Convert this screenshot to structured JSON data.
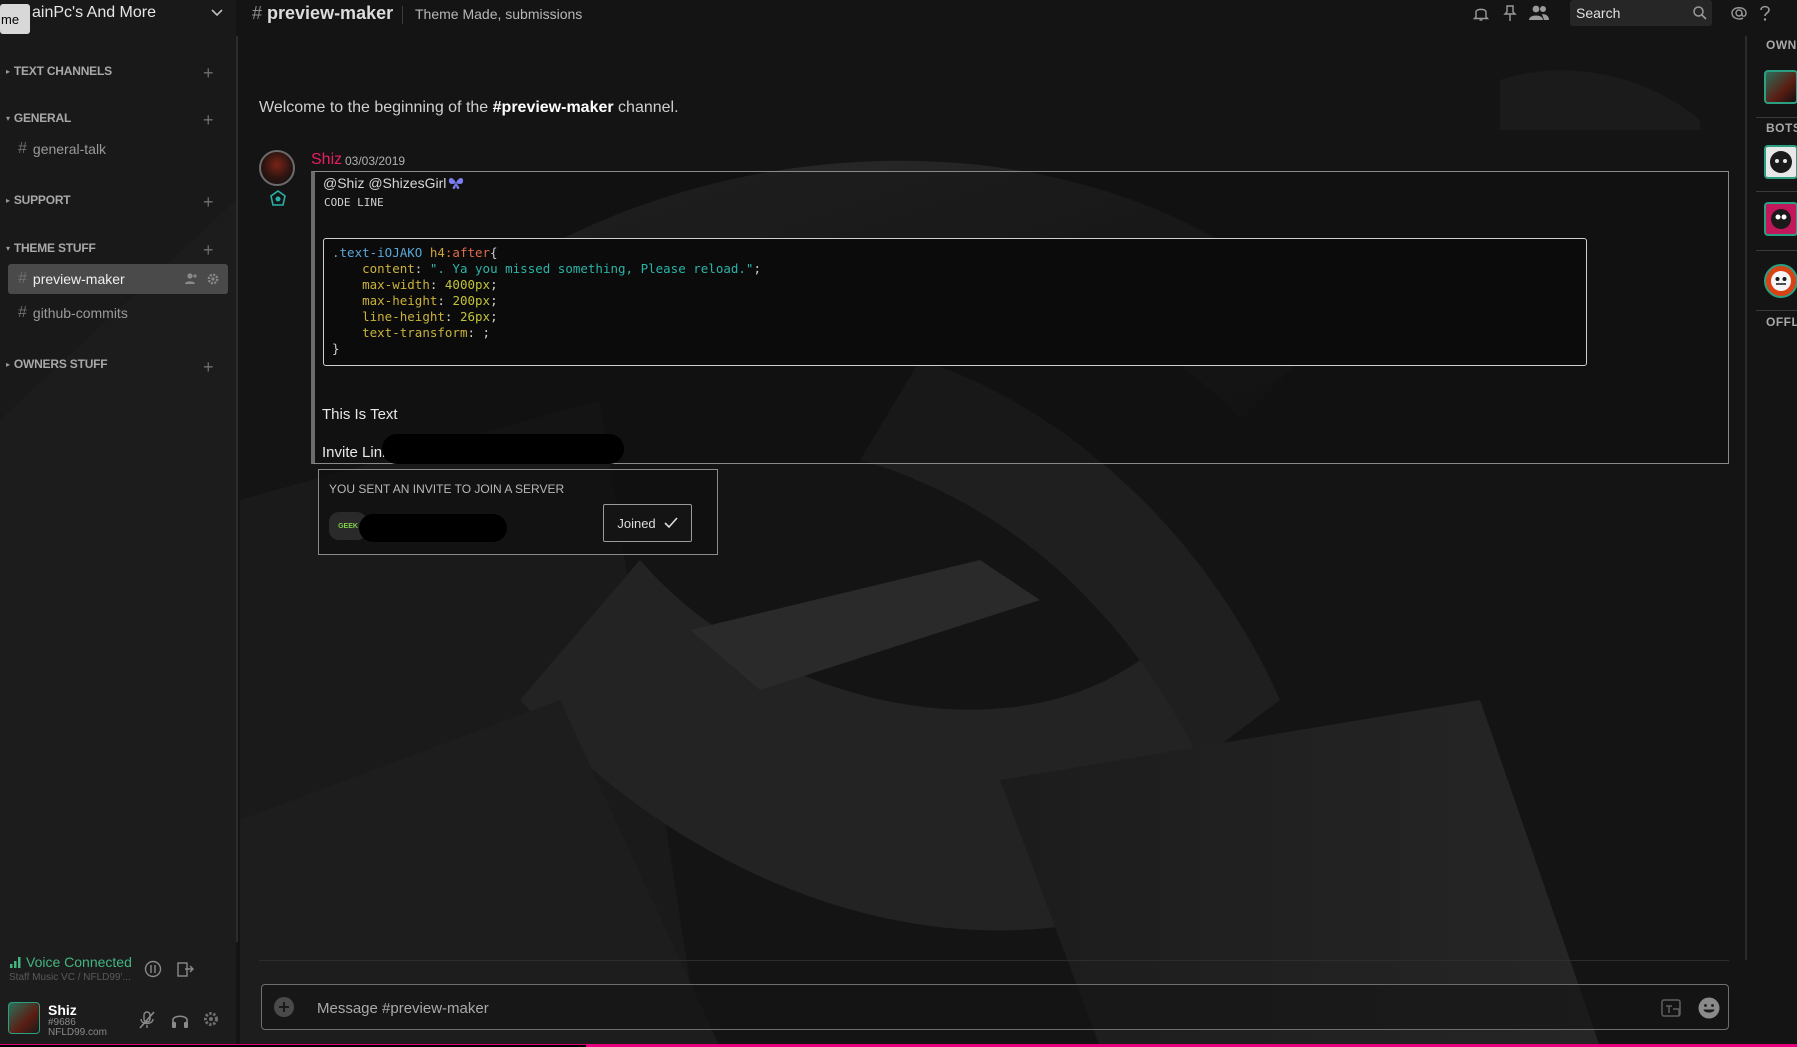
{
  "server": {
    "badge": "me",
    "name": "ainPc's And More"
  },
  "sidebar": {
    "categories": [
      {
        "label": "TEXT CHANNELS"
      },
      {
        "label": "GENERAL"
      },
      {
        "label": "SUPPORT"
      },
      {
        "label": "THEME STUFF"
      },
      {
        "label": "OWNERS STUFF"
      }
    ],
    "channels": [
      {
        "label": "general-talk"
      },
      {
        "label": "preview-maker"
      },
      {
        "label": "github-commits"
      }
    ]
  },
  "voice": {
    "status": "Voice Connected",
    "sub": "Staff Music VC / NFLD99'..."
  },
  "user": {
    "name": "Shiz",
    "discriminator": "#9686",
    "site": "NFLD99.com"
  },
  "topbar": {
    "hash": "#",
    "channel": "preview-maker",
    "topic": "Theme Made, submissions",
    "search_placeholder": "Search"
  },
  "welcome": {
    "prefix": "Welcome to the beginning of the ",
    "channel": "#preview-maker",
    "suffix": " channel."
  },
  "message": {
    "author": "Shiz",
    "timestamp": "03/03/2019",
    "embed": {
      "author": "@Shiz @ShizesGirl",
      "title": "CODE LINE",
      "code": {
        "selector": ".text-iOJAKO",
        "tag": " h4",
        "pseudo": ":after",
        "open": "{",
        "lines": [
          {
            "prop": "content",
            "value": "\". Ya you missed something, Please reload.\"",
            "kind": "str"
          },
          {
            "prop": "max-width",
            "value": "4000px",
            "kind": "num"
          },
          {
            "prop": "max-height",
            "value": "200px",
            "kind": "num"
          },
          {
            "prop": "line-height",
            "value": "26px",
            "kind": "num"
          },
          {
            "prop": "text-transform",
            "value": "",
            "kind": "plain"
          }
        ],
        "close": "}"
      },
      "text1": "This Is Text",
      "text2": "Invite Link"
    },
    "invite": {
      "title": "YOU SENT AN INVITE TO JOIN A SERVER",
      "icon_text": "GEEK",
      "button": "Joined"
    }
  },
  "composer": {
    "placeholder": "Message #preview-maker"
  },
  "members": {
    "categories": [
      "OWN",
      "BOTS",
      "OFFL"
    ]
  },
  "colors": {
    "author": "#e91e63",
    "voice": "#43b581",
    "accent_bar": "#e6007e"
  }
}
